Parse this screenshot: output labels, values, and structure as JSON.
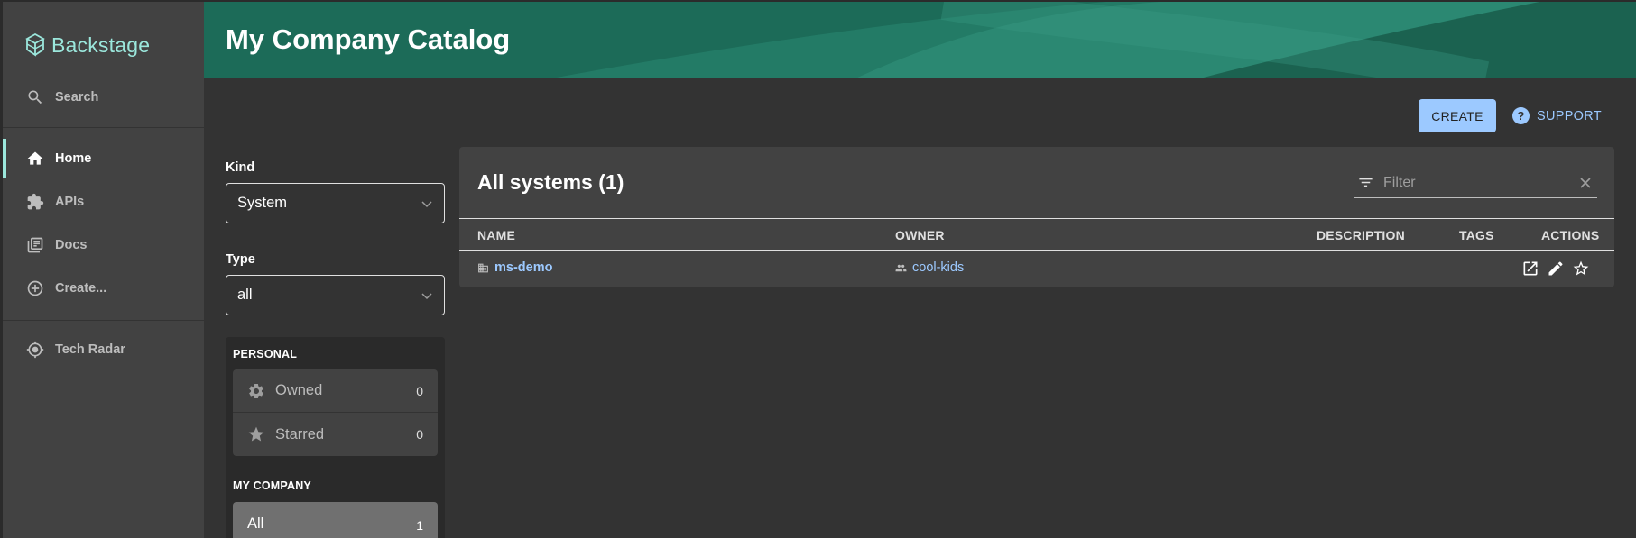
{
  "app": {
    "logo_text": "Backstage"
  },
  "sidebar": {
    "search_label": "Search",
    "items": [
      {
        "label": "Home",
        "icon": "home-icon",
        "active": true
      },
      {
        "label": "APIs",
        "icon": "puzzle-icon"
      },
      {
        "label": "Docs",
        "icon": "library-icon"
      },
      {
        "label": "Create...",
        "icon": "add-circle-icon"
      },
      {
        "label": "Tech Radar",
        "icon": "radar-icon"
      }
    ]
  },
  "header": {
    "title": "My Company Catalog"
  },
  "toolbar": {
    "create_label": "CREATE",
    "support_label": "SUPPORT"
  },
  "filters": {
    "kind_label": "Kind",
    "kind_value": "System",
    "type_label": "Type",
    "type_value": "all",
    "personal_title": "PERSONAL",
    "owned_label": "Owned",
    "owned_count": "0",
    "starred_label": "Starred",
    "starred_count": "0",
    "company_title": "MY COMPANY",
    "all_label": "All",
    "all_count": "1"
  },
  "table": {
    "title": "All systems (1)",
    "filter_placeholder": "Filter",
    "columns": [
      "NAME",
      "OWNER",
      "DESCRIPTION",
      "TAGS",
      "ACTIONS"
    ],
    "rows": [
      {
        "name": "ms-demo",
        "owner": "cool-kids",
        "description": "",
        "tags": ""
      }
    ]
  },
  "colors": {
    "accent": "#9cc9ff",
    "brand_teal": "#9be7dc",
    "header": "#1f6f5c",
    "background": "#333333",
    "sidebar": "#424242"
  }
}
